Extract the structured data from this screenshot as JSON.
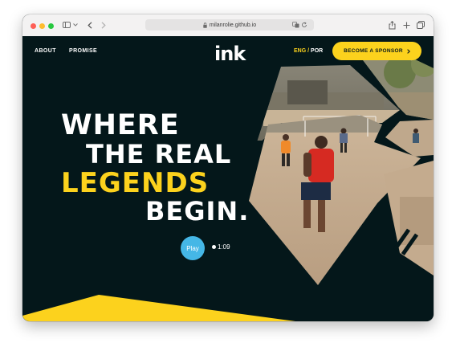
{
  "browser": {
    "url": "milanrolie.github.io"
  },
  "nav": {
    "about": "ABOUT",
    "promise": "PROMISE"
  },
  "logo": "ink",
  "lang": {
    "eng": "ENG",
    "sep": "/",
    "por": "POR"
  },
  "sponsor_label": "BECOME A SPONSOR",
  "headline": {
    "line1": "WHERE",
    "line2": "THE REAL",
    "line3": "LEGENDS",
    "line4": "BEGIN."
  },
  "video": {
    "play_label": "Play",
    "duration": "1:09"
  },
  "colors": {
    "background": "#04171a",
    "accent_yellow": "#fcd21d",
    "play_blue": "#45b7e6"
  }
}
